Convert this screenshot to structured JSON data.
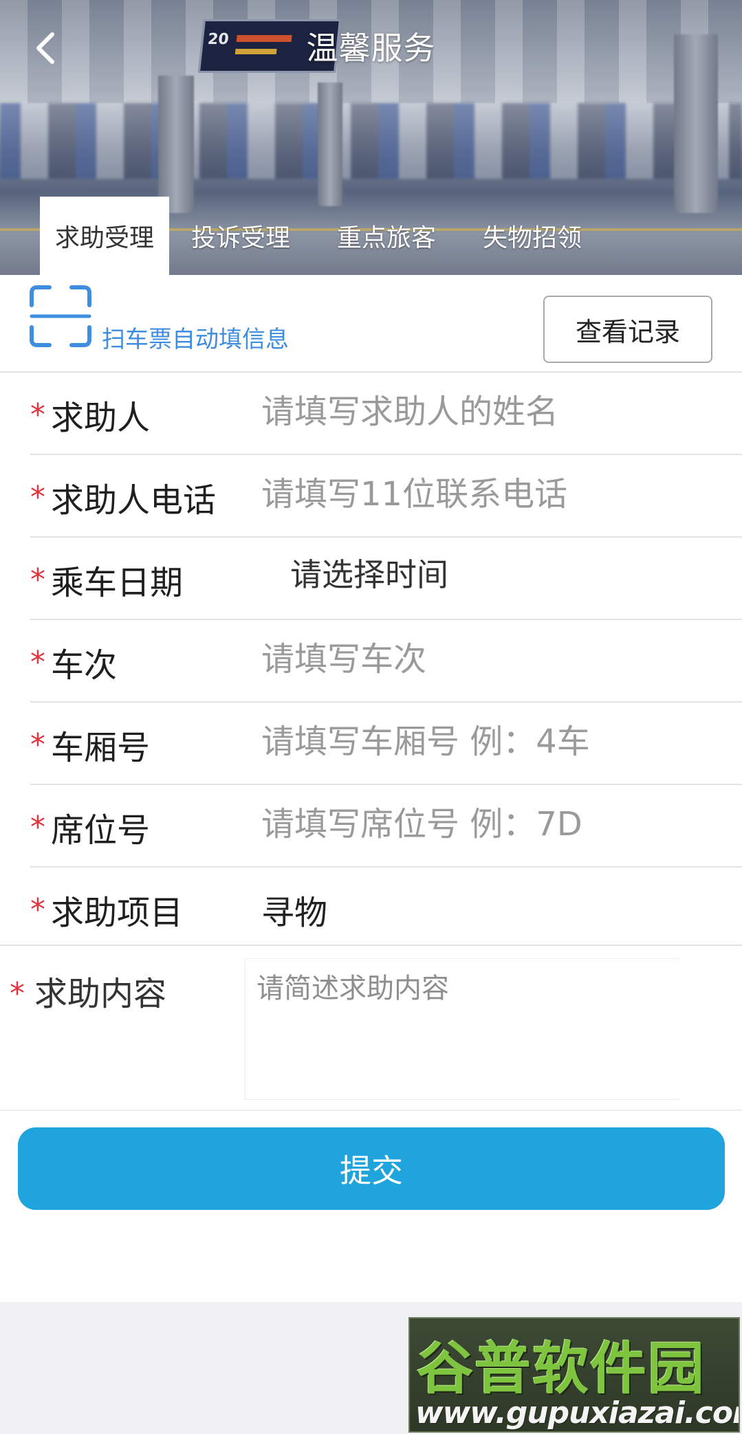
{
  "header": {
    "title": "温馨服务",
    "sign_number": "20"
  },
  "tabs": [
    {
      "label": "求助受理",
      "active": true
    },
    {
      "label": "投诉受理",
      "active": false
    },
    {
      "label": "重点旅客",
      "active": false
    },
    {
      "label": "失物招领",
      "active": false
    }
  ],
  "scan": {
    "text": "扫车票自动填信息",
    "record_button": "查看记录"
  },
  "form": {
    "required_mark": "*",
    "rows": [
      {
        "label": "求助人",
        "placeholder": "请填写求助人的姓名"
      },
      {
        "label": "求助人电话",
        "placeholder": "请填写11位联系电话"
      },
      {
        "label": "乘车日期",
        "value": "请选择时间"
      },
      {
        "label": "车次",
        "placeholder": "请填写车次"
      },
      {
        "label": "车厢号",
        "placeholder": "请填写车厢号 例：4车"
      },
      {
        "label": "席位号",
        "placeholder": "请填写席位号 例：7D"
      },
      {
        "label": "求助项目",
        "value": "寻物"
      }
    ],
    "content": {
      "label": "求助内容",
      "placeholder": "请简述求助内容"
    },
    "submit_label": "提交"
  },
  "watermark": {
    "name": "谷普软件园",
    "url": "www.gupuxiazai.com"
  },
  "colors": {
    "accent": "#1fa4dd",
    "link_blue": "#3d8ee0",
    "required_red": "#e2333d"
  }
}
